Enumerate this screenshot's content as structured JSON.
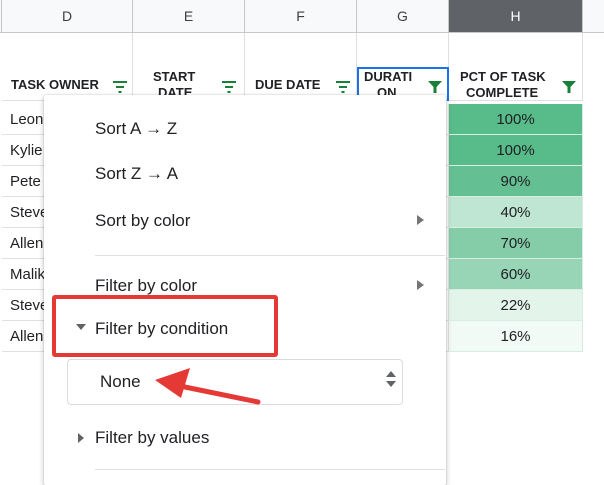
{
  "columns": [
    {
      "letter": "D",
      "header": "TASK OWNER"
    },
    {
      "letter": "E",
      "header_line1": "START",
      "header_line2": "DATE"
    },
    {
      "letter": "F",
      "header": "DUE DATE"
    },
    {
      "letter": "G",
      "header_line1": "DURATI",
      "header_line2": "ON"
    },
    {
      "letter": "H",
      "header_line1": "PCT OF TASK",
      "header_line2": "COMPLETE"
    }
  ],
  "rows": [
    {
      "owner": "Leon",
      "pct": "100%",
      "pct_value": 1.0,
      "color": "#57bb8a"
    },
    {
      "owner": "Kylie",
      "pct": "100%",
      "pct_value": 1.0,
      "color": "#57bb8a"
    },
    {
      "owner": "Pete",
      "pct": "90%",
      "pct_value": 0.9,
      "color": "#64c093"
    },
    {
      "owner": "Steve",
      "pct": "40%",
      "pct_value": 0.4,
      "color": "#bfe6d2"
    },
    {
      "owner": "Allen",
      "pct": "70%",
      "pct_value": 0.7,
      "color": "#85cda9"
    },
    {
      "owner": "Malik",
      "pct": "60%",
      "pct_value": 0.6,
      "color": "#97d5b6"
    },
    {
      "owner": "Steve",
      "pct": "22%",
      "pct_value": 0.22,
      "color": "#e3f4eb"
    },
    {
      "owner": "Allen",
      "pct": "16%",
      "pct_value": 0.16,
      "color": "#f2faf6"
    }
  ],
  "menu": {
    "sort_az": "Sort A → Z",
    "sort_za": "Sort Z → A",
    "sort_by_color": "Sort by color",
    "filter_by_color": "Filter by color",
    "filter_by_condition": "Filter by condition",
    "condition_value": "None",
    "filter_by_values": "Filter by values"
  },
  "colors": {
    "filter_icon": "#188038",
    "selection_border": "#1a73e8",
    "highlight": "#e53935",
    "selected_col_header": "#5f6368"
  }
}
